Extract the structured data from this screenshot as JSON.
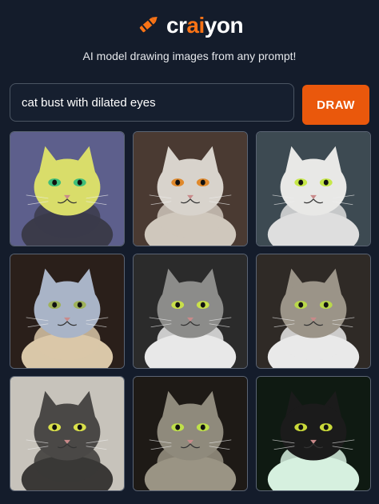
{
  "brand": {
    "prefix": "cr",
    "accent": "ai",
    "suffix": "yon",
    "accent_color": "#f97316"
  },
  "tagline": "AI model drawing images from any prompt!",
  "search": {
    "value": "cat bust with dilated eyes",
    "button_label": "DRAW"
  },
  "results": [
    {
      "bg": "#5d5f8c",
      "fur": "#d9dd6a",
      "eye": "#3fbf7a",
      "base": "#3b3b4a"
    },
    {
      "bg": "#4a3a32",
      "fur": "#d8d3cc",
      "eye": "#e0892c",
      "base": "#cfc7bc"
    },
    {
      "bg": "#3d4a52",
      "fur": "#e8e8e6",
      "eye": "#c7e84a",
      "base": "#dedede"
    },
    {
      "bg": "#2a1f1a",
      "fur": "#a9b4c7",
      "eye": "#9fb25a",
      "base": "#d9c7a8"
    },
    {
      "bg": "#2b2b2b",
      "fur": "#8c8c8a",
      "eye": "#c9e04a",
      "base": "#e8e8e8"
    },
    {
      "bg": "#2f2a26",
      "fur": "#9b9488",
      "eye": "#b9d84a",
      "base": "#e9e9e9"
    },
    {
      "bg": "#c7c3bb",
      "fur": "#4a4846",
      "eye": "#d9e04a",
      "base": "#3a3836"
    },
    {
      "bg": "#1e1a16",
      "fur": "#8f8a7c",
      "eye": "#bfe04a",
      "base": "#9a9484"
    },
    {
      "bg": "#0f1a12",
      "fur": "#1b1b1b",
      "eye": "#c9d93a",
      "base": "#d6f0df"
    }
  ]
}
